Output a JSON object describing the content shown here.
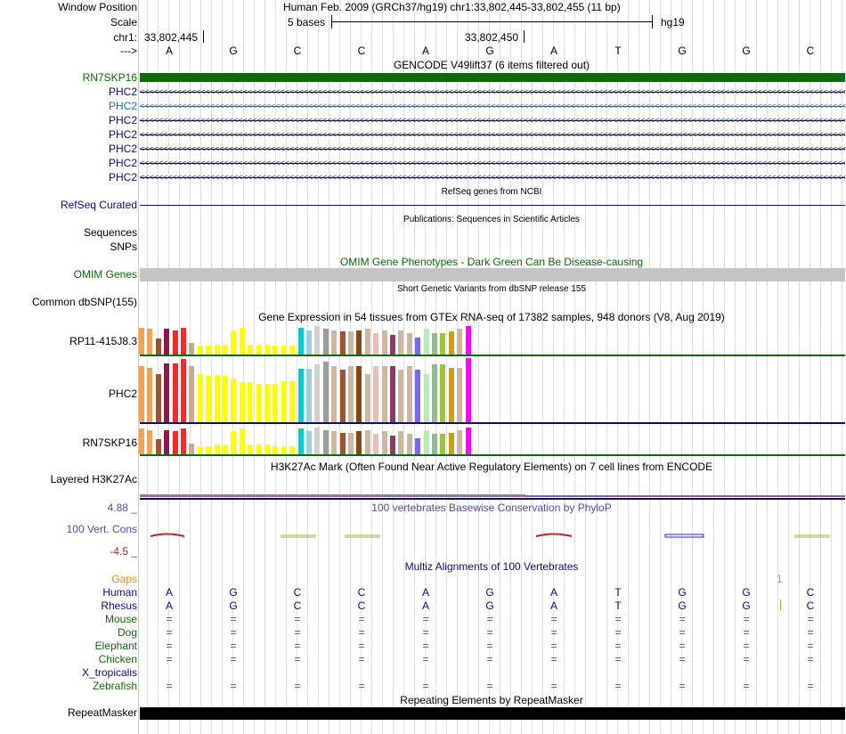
{
  "header": {
    "window_position_label": "Window Position",
    "assembly_text": "Human Feb. 2009 (GRCh37/hg19)   chr1:33,802,445-33,802,455 (11 bp)",
    "scale_label": "Scale",
    "scale_text": "5 bases",
    "scale_assembly": "hg19",
    "chrom_label": "chr1:",
    "coord_left": "33,802,445",
    "coord_mid": "33,802,450",
    "strand_label": "--->"
  },
  "sequence": [
    "A",
    "G",
    "C",
    "C",
    "A",
    "G",
    "A",
    "T",
    "G",
    "G",
    "C"
  ],
  "gencode": {
    "title": "GENCODE V49lift37 (6 items filtered out)",
    "tracks": [
      "RN7SKP16",
      "PHC2",
      "PHC2",
      "PHC2",
      "PHC2",
      "PHC2",
      "PHC2",
      "PHC2"
    ],
    "colors": [
      "#0b6b0b",
      "#0c0c78",
      "#1a6fa8",
      "#0c0c78",
      "#0c0c78",
      "#0c0c78",
      "#0c0c78",
      "#0c0c78"
    ]
  },
  "refseq": {
    "title": "RefSeq genes from NCBI",
    "label": "RefSeq Curated"
  },
  "publications": {
    "title": "Publications: Sequences in Scientific Articles",
    "label1": "Sequences",
    "label2": "SNPs"
  },
  "omim": {
    "title": "OMIM Gene Phenotypes - Dark Green Can Be Disease-causing",
    "label": "OMIM Genes"
  },
  "dbsnp": {
    "title": "Short Genetic Variants from dbSNP release 155",
    "label": "Common dbSNP(155)"
  },
  "gtex": {
    "title": "Gene Expression in 54 tissues from GTEx RNA-seq of 17382 samples, 948 donors (V8, Aug 2019)",
    "genes": [
      "RP11-415J8.3",
      "PHC2",
      "RN7SKP16"
    ],
    "tissue_colors": [
      "#f6a24c",
      "#f6a24c",
      "#a0522d",
      "#8b1a4a",
      "#ee2c2c",
      "#ee2c2c",
      "#c8a991",
      "#ffff00",
      "#ffff00",
      "#ffff00",
      "#ffff00",
      "#ffff00",
      "#ffff00",
      "#ffff00",
      "#ffff00",
      "#ffff00",
      "#ffff00",
      "#ffff00",
      "#ffff00",
      "#00cdcd",
      "#9bcdde",
      "#d0d0d0",
      "#9c9c9c",
      "#cdb79e",
      "#a0522d",
      "#cdb79e",
      "#8b4513",
      "#cdb79e",
      "#eebbbb",
      "#cdb79e",
      "#8b3a62",
      "#cdb79e",
      "#cdb79e",
      "#7a67ee",
      "#b4eeb4",
      "#8fbc8f",
      "#99c633",
      "#cd9b1d",
      "#cdb79e",
      "#ff00ff"
    ],
    "heights_gene1": [
      0.95,
      0.9,
      0.55,
      0.9,
      0.85,
      0.95,
      0.4,
      0.3,
      0.3,
      0.35,
      0.35,
      0.85,
      0.95,
      0.35,
      0.35,
      0.35,
      0.3,
      0.3,
      0.3,
      0.95,
      0.85,
      1.0,
      0.9,
      0.85,
      0.8,
      0.8,
      0.85,
      0.9,
      0.75,
      0.85,
      0.7,
      0.85,
      0.75,
      0.6,
      0.9,
      0.75,
      0.75,
      0.8,
      0.9,
      1.0
    ],
    "heights_gene2": [
      0.88,
      0.85,
      0.75,
      0.92,
      0.92,
      0.98,
      0.88,
      0.75,
      0.72,
      0.74,
      0.72,
      0.68,
      0.62,
      0.62,
      0.6,
      0.6,
      0.6,
      0.64,
      0.64,
      0.84,
      0.84,
      0.9,
      0.95,
      0.88,
      0.82,
      0.88,
      0.88,
      0.75,
      0.88,
      0.88,
      0.88,
      0.82,
      0.88,
      0.82,
      0.75,
      0.9,
      0.9,
      0.85,
      0.85,
      1.0
    ],
    "heights_gene3": [
      0.95,
      0.9,
      0.55,
      0.9,
      0.85,
      0.95,
      0.4,
      0.3,
      0.3,
      0.35,
      0.35,
      0.85,
      0.95,
      0.35,
      0.35,
      0.35,
      0.3,
      0.3,
      0.3,
      0.95,
      0.85,
      1.0,
      0.9,
      0.85,
      0.8,
      0.8,
      0.85,
      0.9,
      0.75,
      0.85,
      0.7,
      0.85,
      0.75,
      0.6,
      0.9,
      0.75,
      0.75,
      0.8,
      0.9,
      1.0
    ]
  },
  "h3k27ac": {
    "title": "H3K27Ac Mark (Often Found Near Active Regulatory Elements) on 7 cell lines from ENCODE",
    "label": "Layered H3K27Ac"
  },
  "cons": {
    "title": "100 vertebrates Basewise Conservation by PhyloP",
    "label": "100 Vert. Cons",
    "max": "4.88 _",
    "min": "-4.5 _"
  },
  "multiz": {
    "title": "Multiz Alignments of 100 Vertebrates",
    "gaps_label": "Gaps",
    "gaps_value": "1",
    "species": [
      "Human",
      "Rhesus",
      "Mouse",
      "Dog",
      "Elephant",
      "Chicken",
      "X_tropicalis",
      "Zebrafish"
    ],
    "human_seq": [
      "A",
      "G",
      "C",
      "C",
      "A",
      "G",
      "A",
      "T",
      "G",
      "G",
      "C"
    ],
    "rhesus_seq": [
      "A",
      "G",
      "C",
      "C",
      "A",
      "G",
      "A",
      "T",
      "G",
      "G",
      "C"
    ],
    "eq": "="
  },
  "repeatmasker": {
    "title": "Repeating Elements by RepeatMasker",
    "label": "RepeatMasker"
  }
}
